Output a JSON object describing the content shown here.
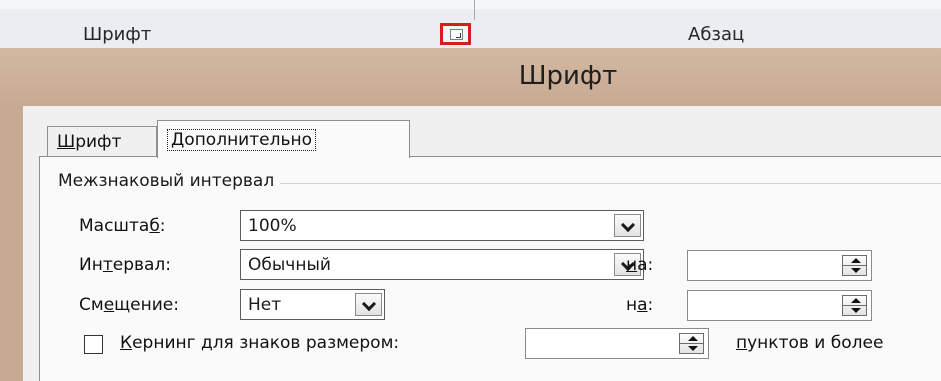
{
  "ribbon": {
    "font_group_label": "Шрифт",
    "paragraph_group_label": "Абзац",
    "launcher_icon": "dialog-launcher-icon",
    "highlight_color": "#d41f1f"
  },
  "dialog": {
    "title": "Шрифт",
    "title_color": "#c7aa92",
    "tabs": [
      {
        "pre": "",
        "u": "Ш",
        "post": "рифт"
      },
      {
        "pre": "До",
        "u": "",
        "post": "полнительно",
        "active": true
      }
    ],
    "section_label": "Межзнаковый интервал",
    "scale": {
      "label_pre": "Масшта",
      "label_u": "б",
      "label_post": ":",
      "value": "100%"
    },
    "spacing": {
      "label_pre": "Ин",
      "label_u": "т",
      "label_post": "ервал:",
      "value": "Обычный",
      "by_pre": "",
      "by_u": "н",
      "by_post": "а:",
      "by_value": ""
    },
    "position": {
      "label_pre": "См",
      "label_u": "е",
      "label_post": "щение:",
      "value": "Нет",
      "by_pre": "н",
      "by_u": "а",
      "by_post": ":",
      "by_value": ""
    },
    "kerning": {
      "label_u": "К",
      "label_post": "ернинг для знаков размером:",
      "value": "",
      "suffix_u": "п",
      "suffix_post": "унктов и более",
      "checked": false
    }
  }
}
